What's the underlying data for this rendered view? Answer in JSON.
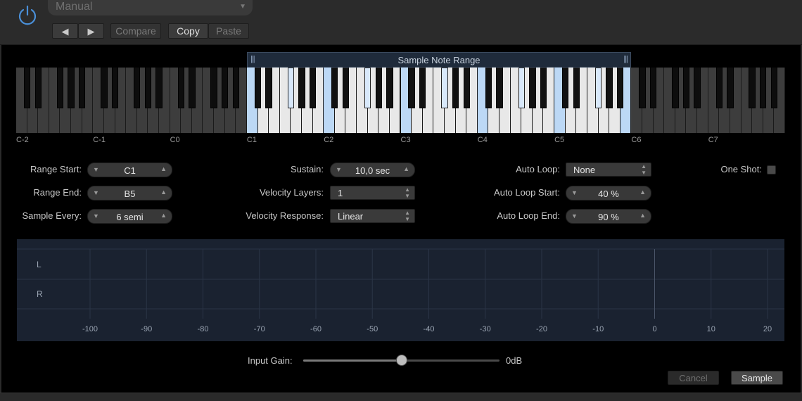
{
  "header": {
    "preset": "Manual",
    "compare_label": "Compare",
    "copy_label": "Copy",
    "paste_label": "Paste",
    "prev_glyph": "◀",
    "next_glyph": "▶"
  },
  "keyboard": {
    "range_title": "Sample Note Range",
    "octave_labels": [
      "C-2",
      "C-1",
      "C0",
      "C1",
      "C2",
      "C3",
      "C4",
      "C5",
      "C6",
      "C7"
    ],
    "range_start_key": "C1",
    "range_end_key": "B5",
    "active_key_color": "#e8e8e8",
    "sample_key_color": "#bcd8f5",
    "inactive_key_color": "#3d3d3d"
  },
  "params": {
    "range_start": {
      "label": "Range Start:",
      "value": "C1"
    },
    "range_end": {
      "label": "Range End:",
      "value": "B5"
    },
    "sample_every": {
      "label": "Sample Every:",
      "value": "6 semi"
    },
    "sustain": {
      "label": "Sustain:",
      "value": "10,0 sec"
    },
    "velocity_layers": {
      "label": "Velocity Layers:",
      "value": "1"
    },
    "velocity_response": {
      "label": "Velocity Response:",
      "value": "Linear"
    },
    "auto_loop": {
      "label": "Auto Loop:",
      "value": "None"
    },
    "auto_loop_start": {
      "label": "Auto Loop Start:",
      "value": "40 %"
    },
    "auto_loop_end": {
      "label": "Auto Loop End:",
      "value": "90 %"
    },
    "one_shot": {
      "label": "One Shot:",
      "checked": false
    }
  },
  "meter": {
    "channel_labels": [
      "L",
      "R"
    ],
    "scale": [
      "-100",
      "-90",
      "-80",
      "-70",
      "-60",
      "-50",
      "-40",
      "-30",
      "-20",
      "-10",
      "0",
      "10",
      "20"
    ]
  },
  "gain": {
    "label": "Input Gain:",
    "value": "0dB",
    "level_fraction": 0.5
  },
  "actions": {
    "cancel_label": "Cancel",
    "sample_label": "Sample"
  },
  "colors": {
    "accent_blue": "#4a90d9",
    "range_bar_bg": "#1f2b3b"
  }
}
